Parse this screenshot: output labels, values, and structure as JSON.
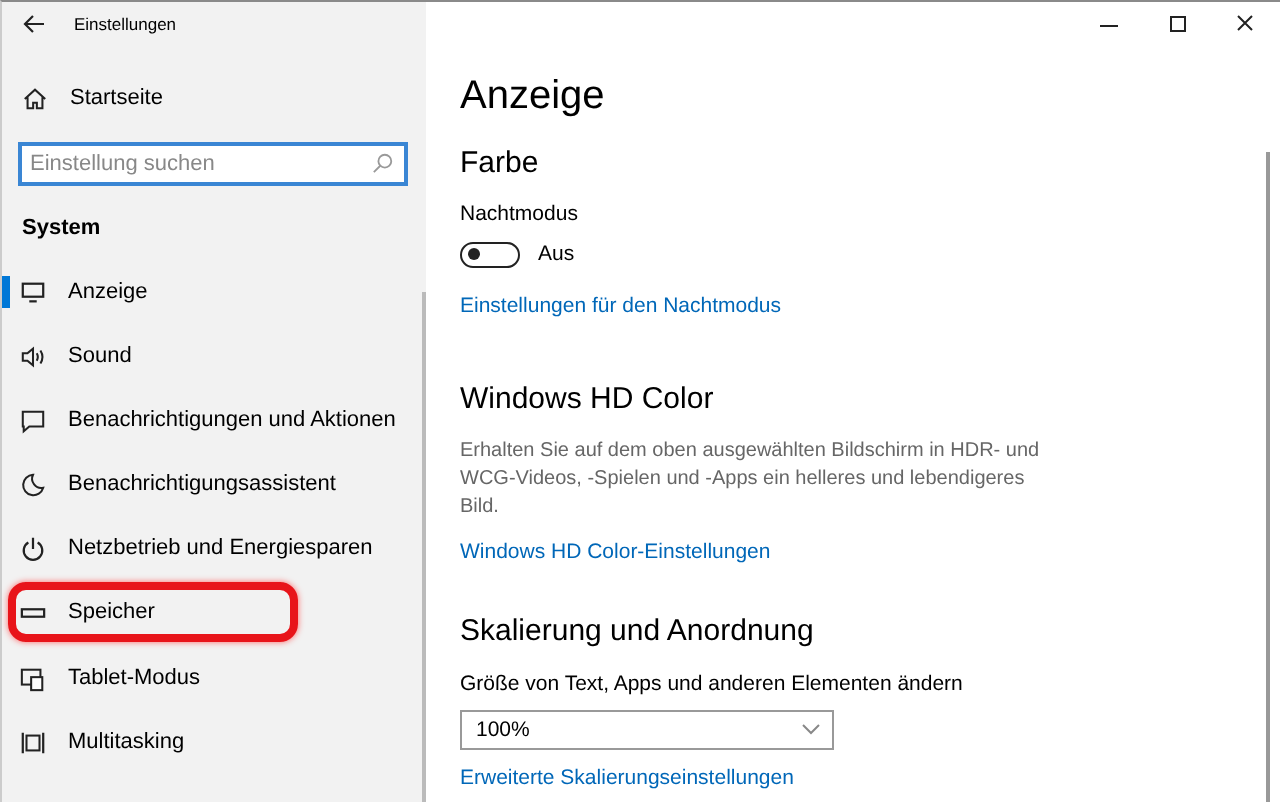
{
  "window": {
    "title": "Einstellungen"
  },
  "sidebar": {
    "home": "Startseite",
    "search": {
      "placeholder": "Einstellung suchen"
    },
    "section": "System",
    "items": [
      {
        "label": "Anzeige",
        "selected": true,
        "highlighted": false
      },
      {
        "label": "Sound",
        "selected": false,
        "highlighted": false
      },
      {
        "label": "Benachrichtigungen und Aktionen",
        "selected": false,
        "highlighted": false
      },
      {
        "label": "Benachrichtigungsassistent",
        "selected": false,
        "highlighted": false
      },
      {
        "label": "Netzbetrieb und Energiesparen",
        "selected": false,
        "highlighted": false
      },
      {
        "label": "Speicher",
        "selected": false,
        "highlighted": true
      },
      {
        "label": "Tablet-Modus",
        "selected": false,
        "highlighted": false
      },
      {
        "label": "Multitasking",
        "selected": false,
        "highlighted": false
      }
    ]
  },
  "page": {
    "title": "Anzeige",
    "sections": [
      {
        "heading": "Farbe",
        "toggle": {
          "label": "Nachtmodus",
          "on": false,
          "state_text": "Aus"
        },
        "link": "Einstellungen für den Nachtmodus"
      },
      {
        "heading": "Windows HD Color",
        "description": "Erhalten Sie auf dem oben ausgewählten Bildschirm in HDR- und WCG-Videos, -Spielen und -Apps ein helleres und lebendigeres Bild.",
        "link": "Windows HD Color-Einstellungen"
      },
      {
        "heading": "Skalierung und Anordnung",
        "dropdown": {
          "label": "Größe von Text, Apps und anderen Elementen ändern",
          "value": "100%"
        },
        "link": "Erweiterte Skalierungseinstellungen"
      }
    ]
  }
}
